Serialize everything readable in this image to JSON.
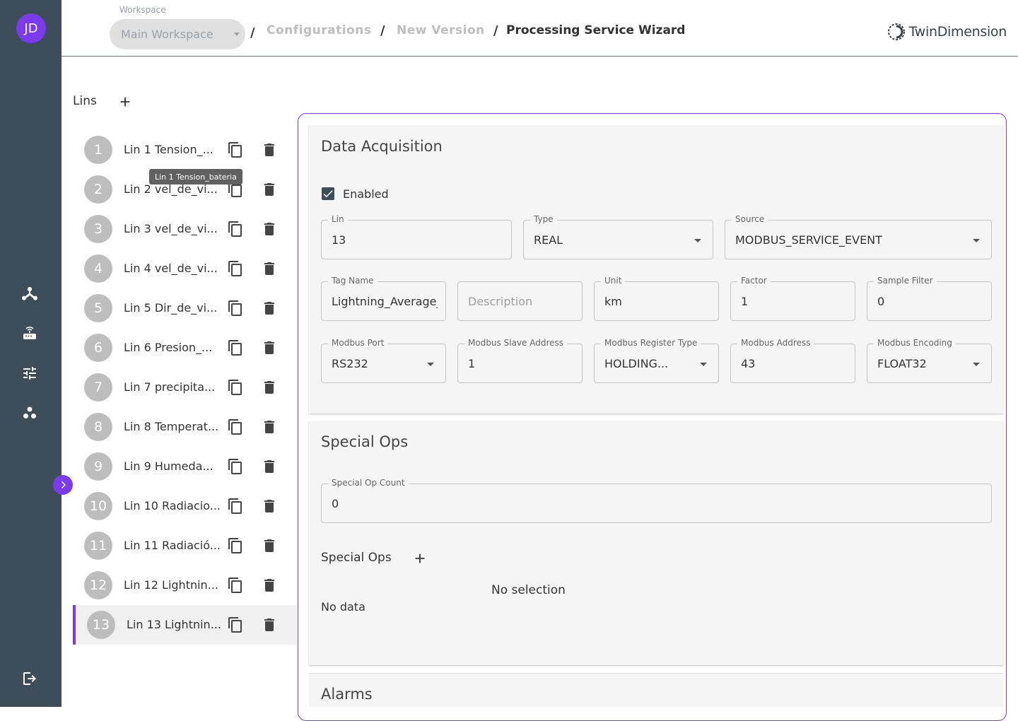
{
  "user": {
    "initials": "JD"
  },
  "header": {
    "workspace_label": "Workspace",
    "workspace_value": "Main Workspace",
    "breadcrumbs": [
      "Configurations",
      "New Version",
      "Processing Service Wizard"
    ],
    "separator": "/",
    "logo_text": "TwinDimension"
  },
  "sidebar": {
    "icons": [
      "network-icon",
      "router-icon",
      "tune-icon",
      "group-icon",
      "logout-icon",
      "chevron-right-icon"
    ]
  },
  "lins": {
    "title": "Lins",
    "tooltip": "Lin 1 Tension_bateria",
    "items": [
      {
        "num": "1",
        "label": "Lin 1 Tension_..."
      },
      {
        "num": "2",
        "label": "Lin 2 vel_de_vi..."
      },
      {
        "num": "3",
        "label": "Lin 3 vel_de_vi..."
      },
      {
        "num": "4",
        "label": "Lin 4 vel_de_vi..."
      },
      {
        "num": "5",
        "label": "Lin 5 Dir_de_vi..."
      },
      {
        "num": "6",
        "label": "Lin 6 Presion_..."
      },
      {
        "num": "7",
        "label": "Lin 7 precipita..."
      },
      {
        "num": "8",
        "label": "Lin 8 Temperat..."
      },
      {
        "num": "9",
        "label": "Lin 9 Humeda..."
      },
      {
        "num": "10",
        "label": "Lin 10 Radiacio..."
      },
      {
        "num": "11",
        "label": "Lin 11 Radiació..."
      },
      {
        "num": "12",
        "label": "Lin 12 Lightnin..."
      },
      {
        "num": "13",
        "label": "Lin 13 Lightnin..."
      }
    ],
    "selected_index": 12
  },
  "data_acquisition": {
    "title": "Data Acquisition",
    "enabled_label": "Enabled",
    "enabled": true,
    "fields": {
      "lin": {
        "label": "Lin",
        "value": "13"
      },
      "type": {
        "label": "Type",
        "value": "REAL"
      },
      "source": {
        "label": "Source",
        "value": "MODBUS_SERVICE_EVENT"
      },
      "tag_name": {
        "label": "Tag Name",
        "value": "Lightning_Average_"
      },
      "description": {
        "label": "",
        "placeholder": "Description"
      },
      "unit": {
        "label": "Unit",
        "value": "km"
      },
      "factor": {
        "label": "Factor",
        "value": "1"
      },
      "sample_filter": {
        "label": "Sample Filter",
        "value": "0"
      },
      "modbus_port": {
        "label": "Modbus Port",
        "value": "RS232"
      },
      "modbus_slave_address": {
        "label": "Modbus Slave Address",
        "value": "1"
      },
      "modbus_register_type": {
        "label": "Modbus Register Type",
        "value": "HOLDING..."
      },
      "modbus_address": {
        "label": "Modbus Address",
        "value": "43"
      },
      "modbus_encoding": {
        "label": "Modbus Encoding",
        "value": "FLOAT32"
      }
    }
  },
  "special_ops": {
    "title": "Special Ops",
    "count_label": "Special Op Count",
    "count_value": "0",
    "list_title": "Special Ops",
    "no_selection": "No selection",
    "no_data": "No data"
  },
  "alarms": {
    "title": "Alarms"
  },
  "colors": {
    "accent": "#7c3aed",
    "sidebar": "#3d4d5a"
  }
}
